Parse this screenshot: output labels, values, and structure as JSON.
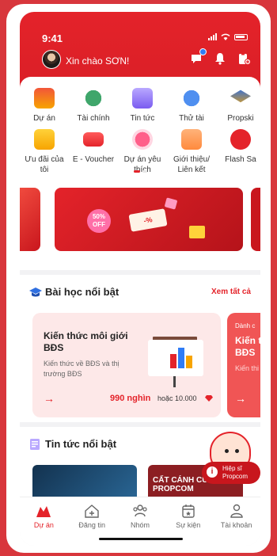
{
  "status_bar": {
    "time": "9:41"
  },
  "header": {
    "greeting": "Xin chào SƠN!"
  },
  "menu_row1": [
    {
      "label": "Dự án",
      "color": "#f2563a"
    },
    {
      "label": "Tài chính",
      "color": "#3fa66b"
    },
    {
      "label": "Tin tức",
      "color": "#7a5cf0"
    },
    {
      "label": "Thử tài",
      "color": "#4f8ff0"
    },
    {
      "label": "Propski",
      "color": "#2f6fe0"
    }
  ],
  "menu_row2": [
    {
      "label": "Ưu đãi của tôi",
      "color": "#f7a400"
    },
    {
      "label": "E - Voucher",
      "color": "#e4232a"
    },
    {
      "label": "Dự án yêu thích",
      "color": "#ff5f8a"
    },
    {
      "label": "Giới thiệu/ Liên kết",
      "color": "#ff8a3d"
    },
    {
      "label": "Flash Sa",
      "color": "#e4232a"
    }
  ],
  "banner": {
    "sale_badge": "50% OFF",
    "voucher_text": "-%"
  },
  "lessons": {
    "title": "Bài học nổi bật",
    "see_all": "Xem tất cả",
    "card1": {
      "title": "Kiến thức môi giới BĐS",
      "desc": "Kiến thức về BĐS và thị trường BĐS",
      "arrow": "→",
      "price": "990 nghìn",
      "alt_price": "hoặc 10.000"
    },
    "card2": {
      "tag": "Dành c",
      "title": "Kiến th BĐS",
      "desc": "Kiến thi trường",
      "arrow": "→"
    }
  },
  "news": {
    "title": "Tin tức nổi bật",
    "thumb2_text": "CẤT CÁNH CÙNG PROPCOM"
  },
  "assistant": {
    "label": "Hiệp sĩ Propcom",
    "icon": "i"
  },
  "tabbar": [
    {
      "label": "Dự án",
      "icon": "project-icon",
      "active": true
    },
    {
      "label": "Đăng tin",
      "icon": "post-icon",
      "active": false
    },
    {
      "label": "Nhóm",
      "icon": "group-icon",
      "active": false
    },
    {
      "label": "Sự kiện",
      "icon": "event-icon",
      "active": false
    },
    {
      "label": "Tài khoản",
      "icon": "account-icon",
      "active": false
    }
  ]
}
